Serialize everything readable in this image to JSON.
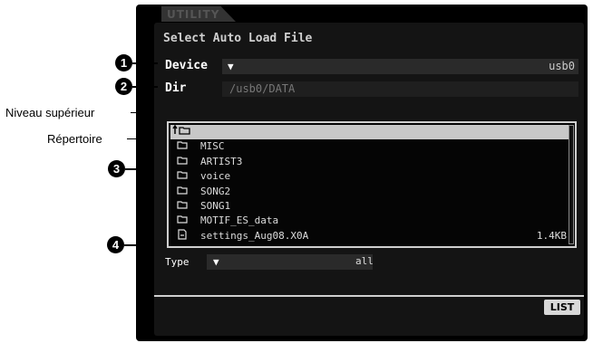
{
  "tab": {
    "label": "UTILITY"
  },
  "title": "Select Auto Load File",
  "device": {
    "label": "Device",
    "dropdown": "▼",
    "value": "usb0"
  },
  "dir": {
    "label": "Dir",
    "value": "/usb0/DATA"
  },
  "files": [
    {
      "icon": "up-folder",
      "name": "",
      "size": ""
    },
    {
      "icon": "folder",
      "name": "MISC",
      "size": ""
    },
    {
      "icon": "folder",
      "name": "ARTIST3",
      "size": ""
    },
    {
      "icon": "folder",
      "name": "voice",
      "size": ""
    },
    {
      "icon": "folder",
      "name": "SONG2",
      "size": ""
    },
    {
      "icon": "folder",
      "name": "SONG1",
      "size": ""
    },
    {
      "icon": "folder",
      "name": "MOTIF_ES_data",
      "size": ""
    },
    {
      "icon": "file",
      "name": "settings_Aug08.X0A",
      "size": "1.4KB"
    }
  ],
  "type": {
    "label": "Type",
    "dropdown": "▼",
    "value": "all"
  },
  "list_button": "LIST",
  "callouts": {
    "n1": "1",
    "n2": "2",
    "n3": "3",
    "n4": "4",
    "parent_level": "Niveau supérieur",
    "directory": "Répertoire"
  }
}
